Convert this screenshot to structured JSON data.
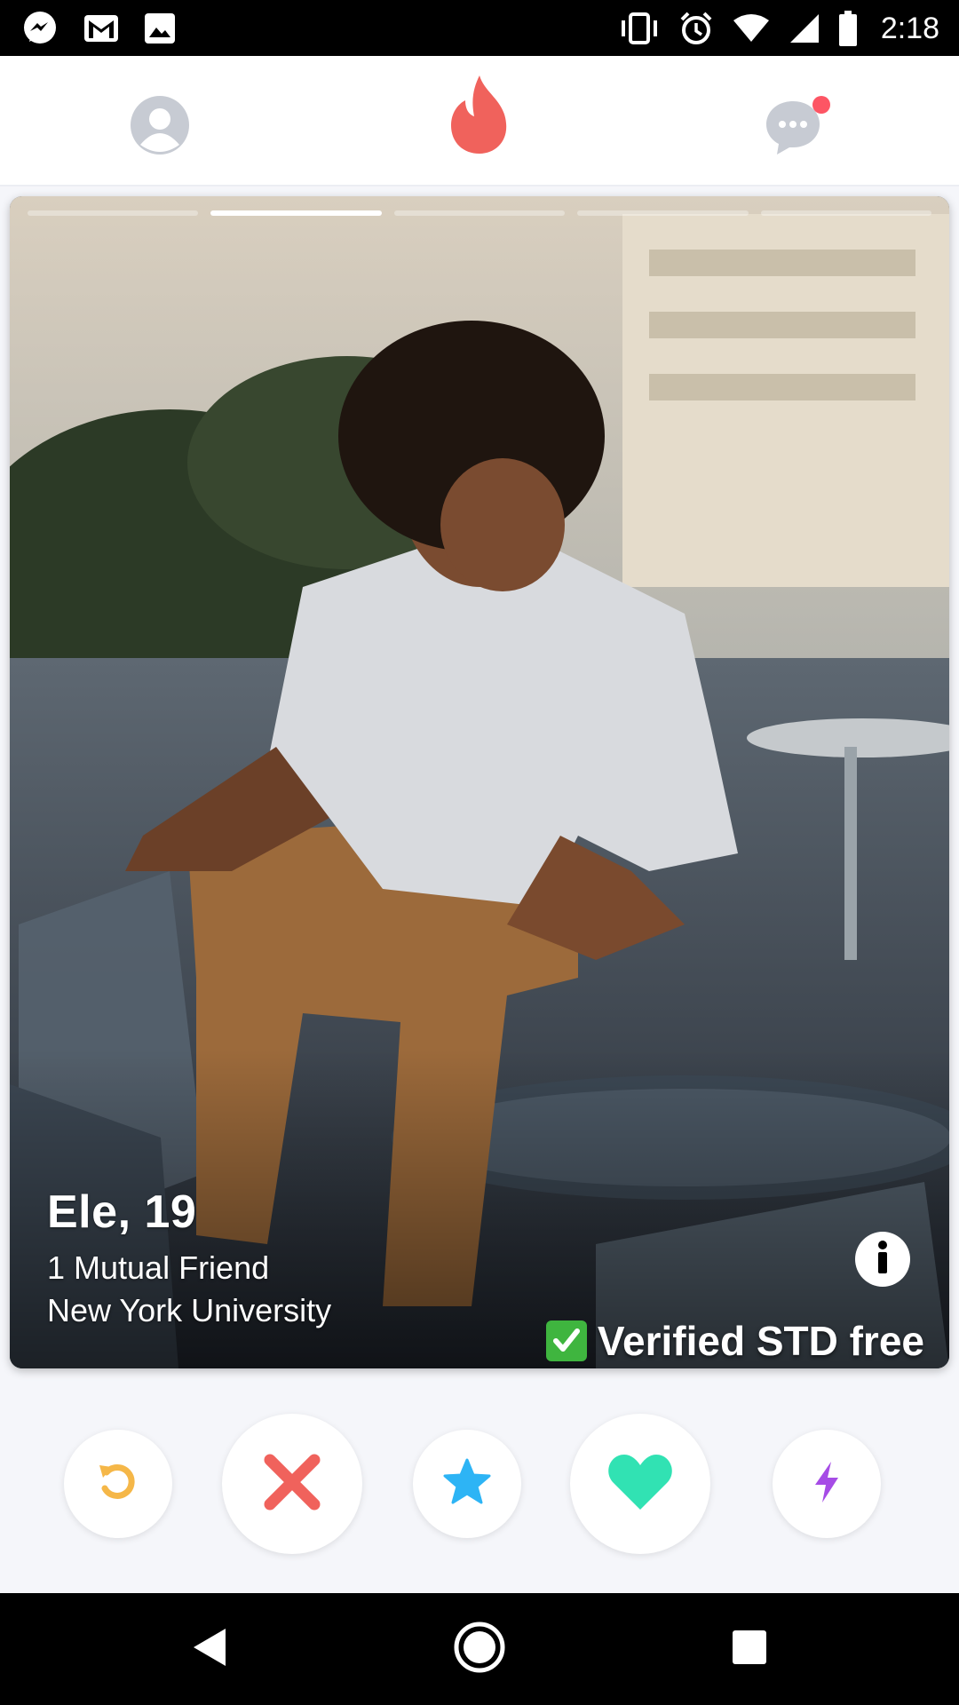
{
  "status_bar": {
    "time": "2:18",
    "icons": [
      "messenger-icon",
      "gmail-icon",
      "image-icon",
      "vibrate-icon",
      "alarm-icon",
      "wifi-icon",
      "signal-icon",
      "battery-icon"
    ]
  },
  "top_nav": {
    "items": [
      "profile-icon",
      "flame-icon",
      "chat-icon"
    ],
    "flame_color": "#f0625c",
    "chat_badge_color": "#fd5564"
  },
  "profile": {
    "name": "Ele",
    "separator": ",",
    "age": "19",
    "mutual_friends": "1 Mutual Friend",
    "school": "New York University",
    "verified_badge": "Verified STD free",
    "photo_count": 5,
    "active_photo": 2
  },
  "actions": {
    "rewind_color": "#f5b748",
    "nope_color": "#f0625c",
    "super_like_color": "#2db4f5",
    "like_color": "#31e2b3",
    "boost_color": "#a64ce6"
  },
  "android_nav": [
    "back-icon",
    "home-icon",
    "recents-icon"
  ]
}
